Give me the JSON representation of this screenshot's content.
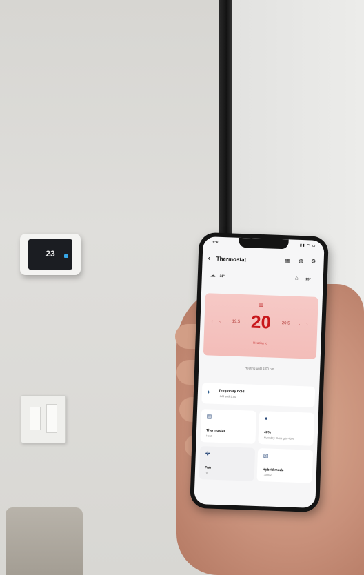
{
  "app": {
    "status_time": "9:41",
    "status_icons": "▮▮ ◠ ▭",
    "title": "Thermostat",
    "back_icon": "‹"
  },
  "weather": {
    "outdoor_temp": "-11°",
    "indoor_temp": "19°"
  },
  "setpoint": {
    "mode_glyph": "▥",
    "low_value": "19.5",
    "value": "20",
    "high_value": "20.5",
    "arrows_left": "‹ ‹",
    "arrows_right": "› ›",
    "state": "Heating to"
  },
  "schedule": {
    "text": "Heating until 4:00 pm"
  },
  "hold": {
    "title": "Temporary hold",
    "subtitle": "Hold until 5:00"
  },
  "tiles": [
    {
      "label": "Thermostat",
      "sub": "Heat"
    },
    {
      "label": "40%",
      "sub": "Humidity: Setting to 40%"
    },
    {
      "label": "Fan",
      "sub": "On"
    },
    {
      "label": "Hybrid mode",
      "sub": "Comfort"
    }
  ],
  "wall_thermostat": {
    "temp": "23"
  },
  "colors": {
    "accent": "#c8181c",
    "card": "#f4c3c0"
  }
}
